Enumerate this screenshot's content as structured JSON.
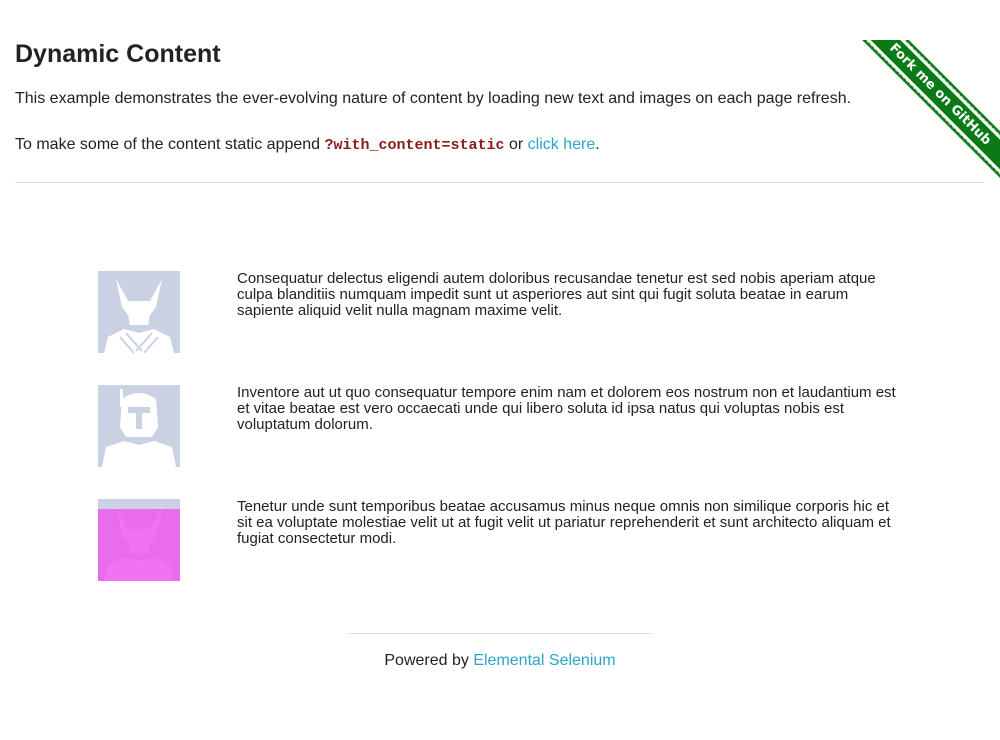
{
  "page": {
    "title": "Dynamic Content",
    "description": "This example demonstrates the ever-evolving nature of content by loading new text and images on each page refresh.",
    "static_prefix": "To make some of the content static append ",
    "static_code": "?with_content=static",
    "static_or": " or ",
    "static_link": "click here",
    "static_suffix": "."
  },
  "ribbon": {
    "label": "Fork me on GitHub",
    "color": "#0a7a16"
  },
  "rows": [
    {
      "avatar_icon": "wolverine-avatar-icon",
      "text": "Consequatur delectus eligendi autem doloribus recusandae tenetur est sed nobis aperiam atque culpa blanditiis numquam impedit sunt ut asperiores aut sint qui fugit soluta beatae in earum sapiente aliquid velit nulla magnam maxime velit."
    },
    {
      "avatar_icon": "boba-fett-avatar-icon",
      "text": "Inventore aut ut quo consequatur tempore enim nam et dolorem eos nostrum non et laudantium est et vitae beatae est vero occaecati unde qui libero soluta id ipsa natus qui voluptas nobis est voluptatum dolorum."
    },
    {
      "avatar_icon": "wolverine-avatar-icon",
      "text": "Tenetur unde sunt temporibus beatae accusamus minus neque omnis non similique corporis hic et sit ea voluptate molestiae velit ut at fugit velit ut pariatur reprehenderit et sunt architecto aliquam et fugiat consectetur modi."
    }
  ],
  "footer": {
    "prefix": "Powered by ",
    "link": "Elemental Selenium"
  },
  "colors": {
    "link": "#2ba6cb",
    "highlight": "#ff7bff",
    "avatar_bg": "#c9d1e3",
    "code": "#8a1b1b"
  }
}
